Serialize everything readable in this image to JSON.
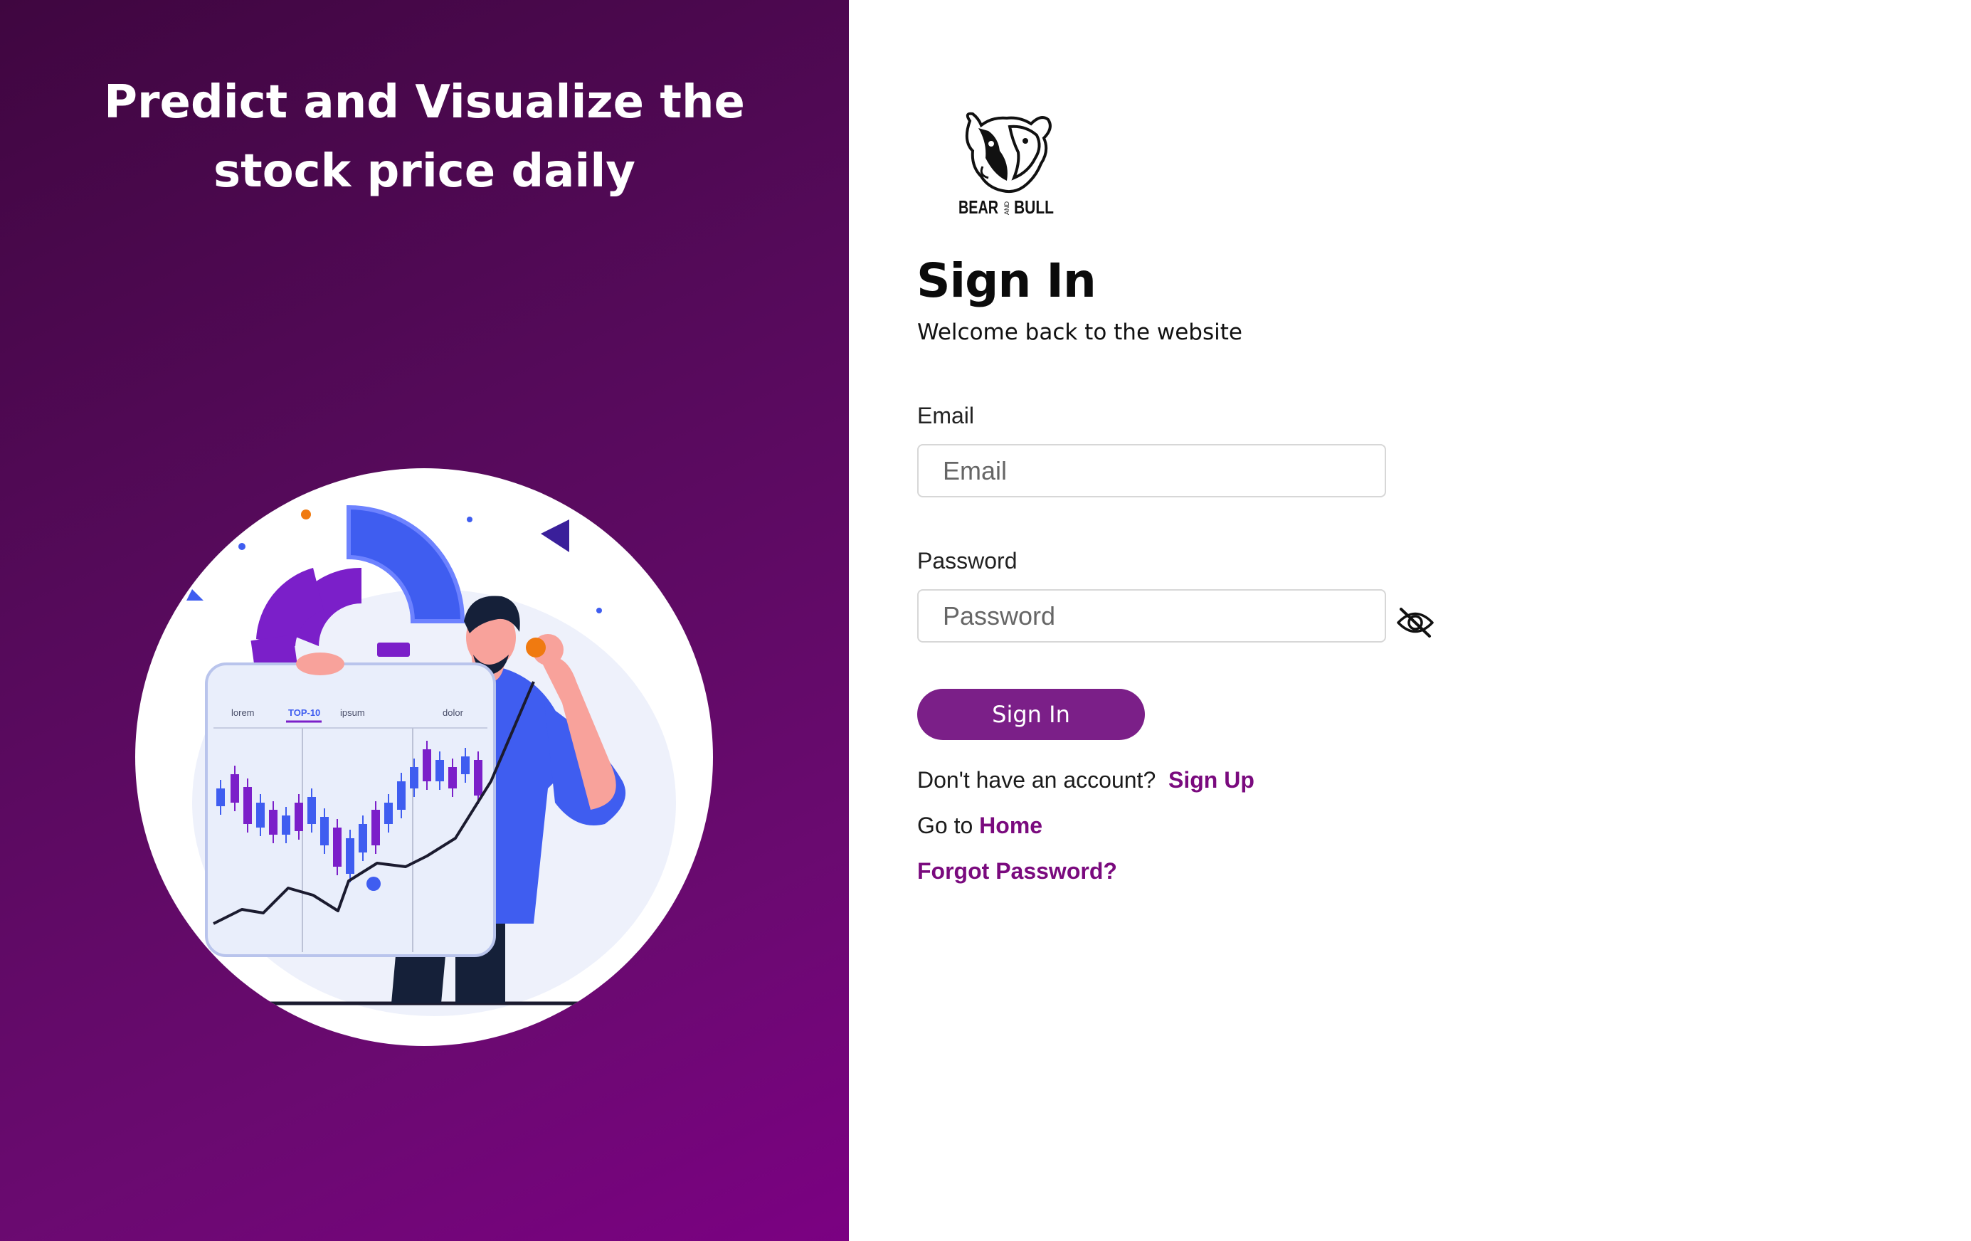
{
  "hero": {
    "title_line1": "Predict and Visualize the",
    "title_line2": "stock price daily"
  },
  "illustration": {
    "chart_tabs": [
      "lorem",
      "TOP-10",
      "ipsum",
      "dolor"
    ],
    "active_tab": "TOP-10"
  },
  "logo": {
    "text_left": "BEAR",
    "text_middle": "AND",
    "text_right": "BULL"
  },
  "form": {
    "title": "Sign In",
    "subtitle": "Welcome back to the website",
    "email_label": "Email",
    "email_placeholder": "Email",
    "email_value": "",
    "password_label": "Password",
    "password_placeholder": "Password",
    "password_value": "",
    "submit_label": "Sign In"
  },
  "links": {
    "signup_prompt": "Don't have an account?",
    "signup_label": "Sign Up",
    "home_prompt": "Go to",
    "home_label": "Home",
    "forgot_label": "Forgot Password?"
  },
  "icons": {
    "password_toggle": "eye-off-icon",
    "logo": "bear-bull-logo-icon"
  },
  "colors": {
    "panel_gradient_start": "#3f0640",
    "panel_gradient_end": "#7b0182",
    "button_bg": "#7b1f88",
    "link": "#7a0a7e",
    "illustration_blue": "#3f5df0",
    "illustration_purple": "#7b1fc9",
    "illustration_orange": "#f07a10"
  }
}
